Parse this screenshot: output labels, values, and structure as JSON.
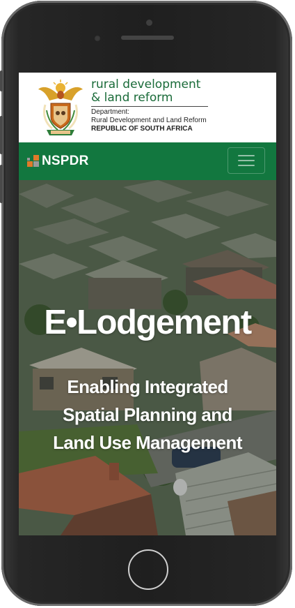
{
  "header": {
    "title_line1": "rural development",
    "title_line2": "& land reform",
    "sub_label": "Department:",
    "department": "Rural Development and Land Reform",
    "country": "REPUBLIC OF SOUTH AFRICA"
  },
  "navbar": {
    "brand": "NSPDR",
    "menu_icon": "hamburger-menu-icon"
  },
  "hero": {
    "title": "E•Lodgement",
    "subtitle_line1": "Enabling Integrated",
    "subtitle_line2": "Spatial Planning and",
    "subtitle_line3": "Land Use Management"
  },
  "colors": {
    "brand_green": "#12773f",
    "header_text_green": "#1a6b39",
    "logo_orange": "#e07a2a",
    "phone_body": "#1f1f1f"
  }
}
